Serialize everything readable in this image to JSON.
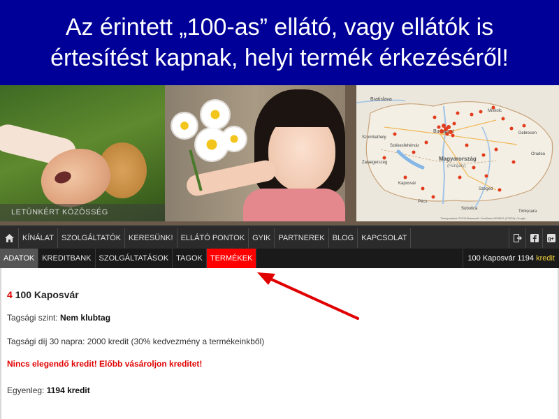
{
  "slide": {
    "title_line1": "Az érintett „100-as” ellátó, vagy ellátók is",
    "title_line2": "értesítést kapnak, helyi termék érkezéséről!"
  },
  "banner": {
    "caption": "LETÜNKÉRT KÖZÖSSÉG",
    "map_label_country": "Magyarország",
    "map_label_country_en": "(Hungary)",
    "map_cities": [
      "Bratislava",
      "Budapest",
      "Székesfehérvár",
      "Kaposvár",
      "Pécs",
      "Szeged",
      "Debrecen",
      "Szombathely",
      "Zalaegerszeg",
      "Timișoara",
      "Subotica",
      "Oradea",
      "Miskolc"
    ],
    "map_attribution": "Térképadatok ©2013 Basarsoft, GeoBasis-DE/BKG (©2009), Google"
  },
  "nav": {
    "home_icon": "home-icon",
    "items": [
      "KÍNÁLAT",
      "SZOLGÁLTATÓK",
      "KERESÜNK!",
      "ELLÁTÓ PONTOK",
      "GYIK",
      "PARTNEREK",
      "BLOG",
      "KAPCSOLAT"
    ],
    "right_icons": [
      "logout-icon",
      "facebook-icon",
      "googleplus-icon"
    ]
  },
  "subnav": {
    "items": [
      "ADATOK",
      "KREDITBANK",
      "SZOLGÁLTATÁSOK",
      "TAGOK",
      "TERMÉKEK"
    ],
    "credit_prefix": "100 Kaposvár 1194",
    "credit_unit": "kredit"
  },
  "content": {
    "member_number": "4",
    "member_name": "100 Kaposvár",
    "level_label": "Tagsági szint:",
    "level_value": "Nem klubtag",
    "fee_text": "Tagsági díj 30 napra: 2000 kredit (30% kedvezmény a termékeinkből)",
    "warning": "Nincs elegendő kredit! Előbb vásároljon kreditet!",
    "balance_label": "Egyenleg:",
    "balance_value": "1194 kredit"
  },
  "colors": {
    "title_bg": "#000099",
    "highlight": "#ff0000",
    "credit_unit": "#f2d23a",
    "arrow": "#e00000"
  }
}
